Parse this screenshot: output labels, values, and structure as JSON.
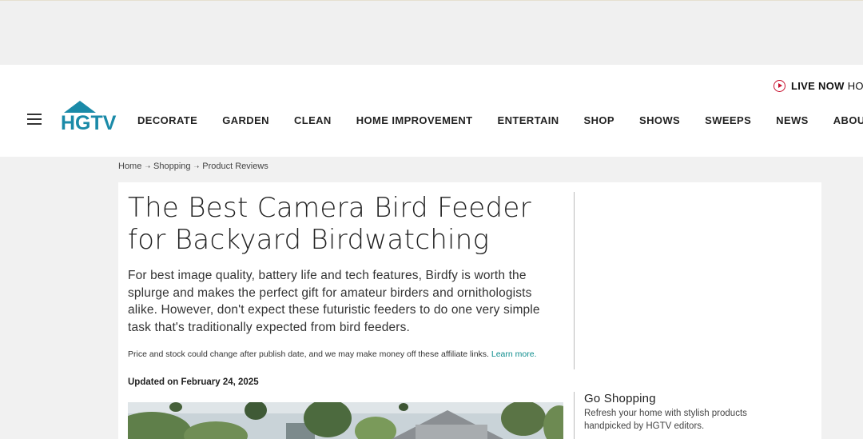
{
  "header": {
    "live_label": "LIVE NOW",
    "live_extra": "HO",
    "logo_text": "HGTV",
    "nav": [
      "DECORATE",
      "GARDEN",
      "CLEAN",
      "HOME IMPROVEMENT",
      "ENTERTAIN",
      "SHOP",
      "SHOWS",
      "SWEEPS",
      "NEWS",
      "ABOUT"
    ]
  },
  "breadcrumb": [
    "Home",
    "Shopping",
    "Product Reviews"
  ],
  "article": {
    "title_line1": "The Best Camera Bird Feeder",
    "title_line2": "for Backyard Birdwatching",
    "dek": "For best image quality, battery life and tech features, Birdfy is worth the splurge and makes the perfect gift for amateur birders and ornithologists alike. However, don't expect these futuristic feeders to do one very simple task that's traditionally expected from bird feeders.",
    "disclosure": "Price and stock could change after publish date, and we may make money off these affiliate links.",
    "learn_more": "Learn more.",
    "updated": "Updated on February 24, 2025"
  },
  "sidebar": {
    "title": "Go Shopping",
    "subtitle": "Refresh your home with stylish products handpicked by HGTV editors."
  },
  "colors": {
    "brand": "#1a8aa8",
    "live_red": "#c8102e",
    "link": "#0e8d8d"
  },
  "icons": {
    "menu": "hamburger-menu-icon",
    "live": "play-circle-icon"
  }
}
